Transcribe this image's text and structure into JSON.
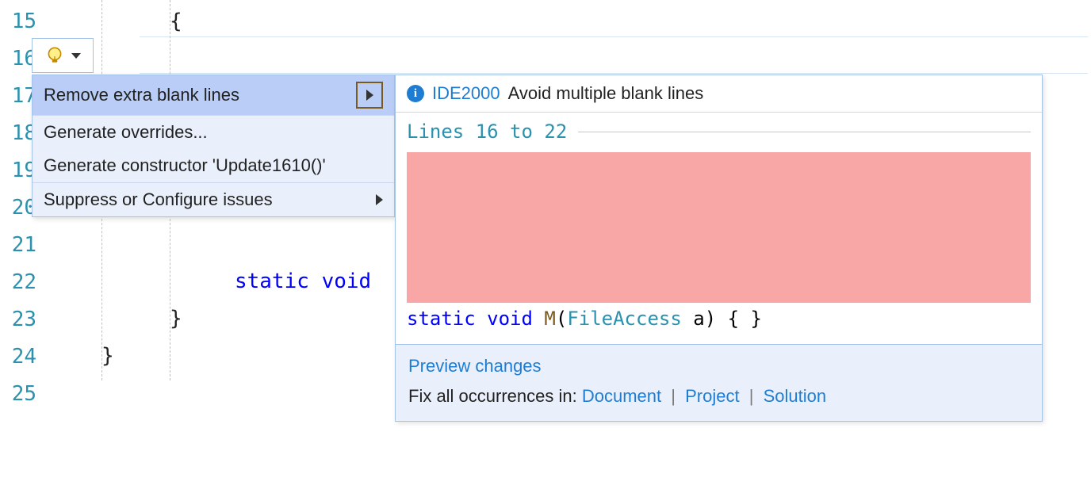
{
  "gutter": {
    "start": 15,
    "lines": [
      "15",
      "16",
      "17",
      "18",
      "19",
      "20",
      "21",
      "22",
      "23",
      "24",
      "25"
    ]
  },
  "code": {
    "brace_open": "{",
    "static_void_fragment_kw": "static void",
    "brace_close_inner": "}",
    "brace_close_outer": "}"
  },
  "lightbulb": {
    "label": "Quick actions"
  },
  "actions": {
    "remove_blank": "Remove extra blank lines",
    "generate_overrides": "Generate overrides...",
    "generate_constructor": "Generate constructor 'Update1610()'",
    "suppress": "Suppress or Configure issues"
  },
  "preview": {
    "rule_id": "IDE2000",
    "rule_desc": "Avoid multiple blank lines",
    "lines_label": "Lines 16 to 22",
    "code_static": "static",
    "code_void": "void",
    "code_method": "M",
    "code_paren_open": "(",
    "code_type": "FileAccess",
    "code_param": " a) { }"
  },
  "footer": {
    "preview_changes": "Preview changes",
    "fix_label": "Fix all occurrences in: ",
    "document": "Document",
    "project": "Project",
    "solution": "Solution"
  }
}
